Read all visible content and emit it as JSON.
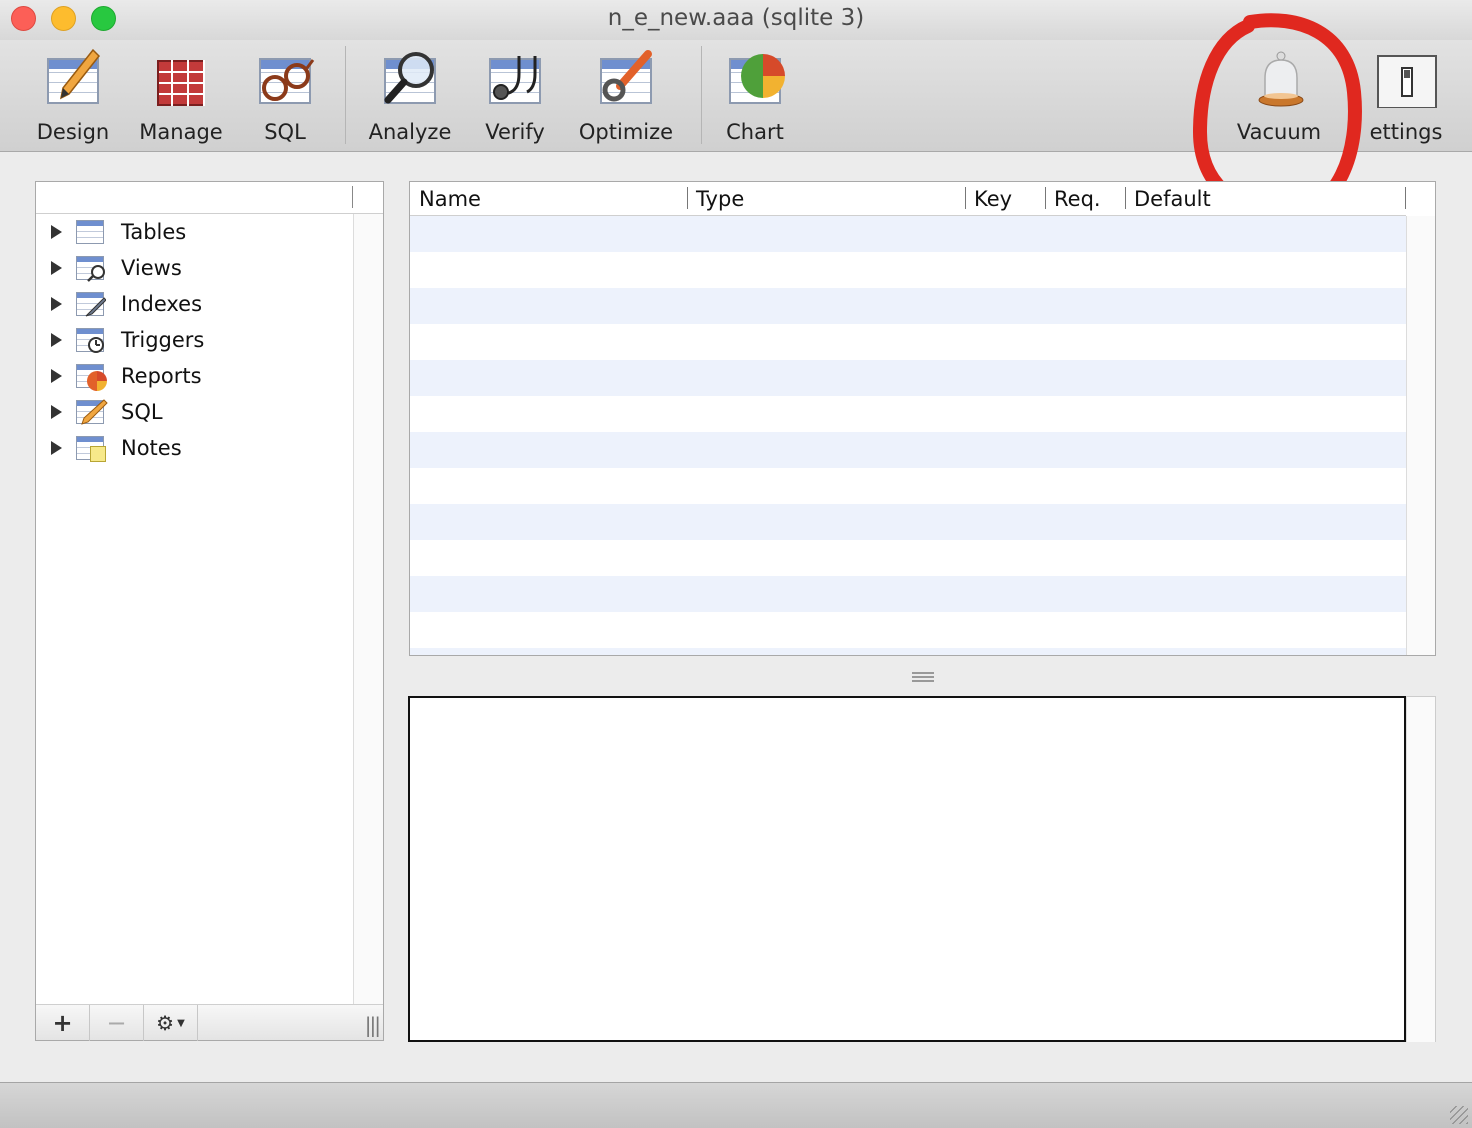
{
  "window": {
    "title": "n_e_new.aaa (sqlite 3)"
  },
  "toolbar": {
    "design": "Design",
    "manage": "Manage",
    "sql": "SQL",
    "analyze": "Analyze",
    "verify": "Verify",
    "optimize": "Optimize",
    "chart": "Chart",
    "vacuum": "Vacuum",
    "settings": "ettings"
  },
  "sidebar": {
    "items": [
      {
        "label": "Tables",
        "icon": "table-icon"
      },
      {
        "label": "Views",
        "icon": "view-icon"
      },
      {
        "label": "Indexes",
        "icon": "index-icon"
      },
      {
        "label": "Triggers",
        "icon": "trigger-icon"
      },
      {
        "label": "Reports",
        "icon": "report-icon"
      },
      {
        "label": "SQL",
        "icon": "sql-icon"
      },
      {
        "label": "Notes",
        "icon": "notes-icon"
      }
    ],
    "footer": {
      "add": "+",
      "remove": "−"
    }
  },
  "columns_table": {
    "headers": [
      "Name",
      "Type",
      "Key",
      "Req.",
      "Default"
    ]
  },
  "annotation": {
    "color": "#e0281f"
  }
}
